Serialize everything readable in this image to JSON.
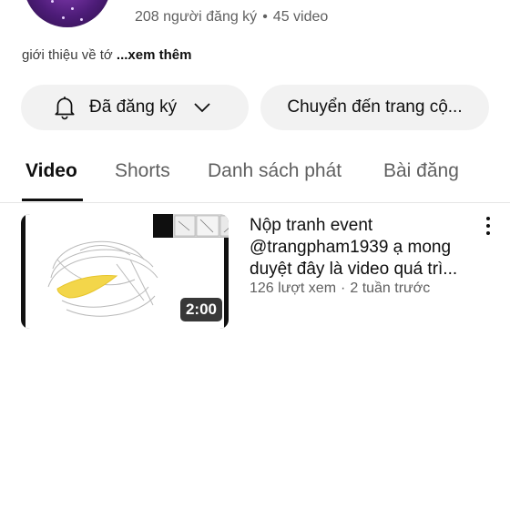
{
  "channel": {
    "stats": {
      "subscribers": "208 người đăng ký",
      "separator": "•",
      "videos": "45 video"
    },
    "about": {
      "text": "giới thiệu về tớ",
      "more": "...xem thêm"
    }
  },
  "actions": {
    "subscribed_label": "Đã đăng ký",
    "community_label": "Chuyển đến trang cộ..."
  },
  "tabs": [
    {
      "label": "Video",
      "active": true
    },
    {
      "label": "Shorts",
      "active": false
    },
    {
      "label": "Danh sách phát",
      "active": false
    },
    {
      "label": "Bài đăng",
      "active": false
    }
  ],
  "videos": [
    {
      "title_lines": [
        "Nộp tranh event",
        "@trangpham1939 ạ mong",
        "duyệt đây là video quá trì..."
      ],
      "views": "126 lượt xem",
      "separator": "·",
      "age": "2 tuần trước",
      "duration": "2:00"
    }
  ],
  "icons": {
    "bell": "bell-icon",
    "chevron": "chevron-down-icon",
    "more": "more-vert-icon"
  },
  "colors": {
    "button_bg": "#f2f2f2",
    "secondary_text": "#606060",
    "primary_text": "#0f0f0f"
  }
}
